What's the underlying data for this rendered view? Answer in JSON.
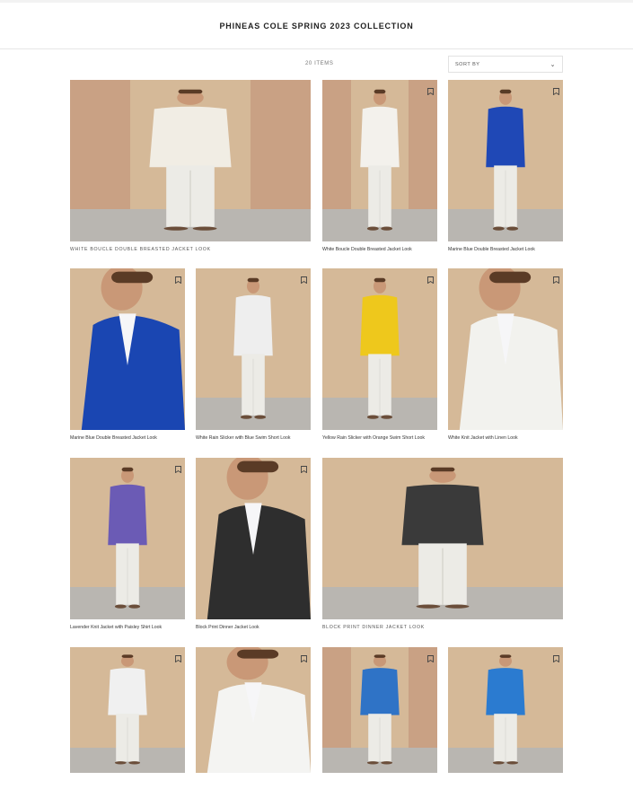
{
  "header": {
    "title": "PHINEAS COLE SPRING 2023 COLLECTION"
  },
  "toolbar": {
    "count": "20 ITEMS",
    "sort_label": "SORT BY"
  },
  "colors": {
    "background": "#ffffff",
    "text": "#222222",
    "studio_beige": "#d5b998",
    "studio_peach": "#c9a184",
    "floor_grey": "#b9b6b1"
  },
  "looks": [
    {
      "label": "WHITE BOUCLE DOUBLE BREASTED JACKET LOOK",
      "icon": "person-photo",
      "jacket": "#f1ede4"
    },
    {
      "label": "White Boucle Double Breasted Jacket Look",
      "icon": "person-photo",
      "jacket": "#f3f1ec"
    },
    {
      "label": "Marine Blue Double Breasted Jacket Look",
      "icon": "person-photo",
      "jacket": "#1f48b6"
    },
    {
      "label": "Marine Blue Double Breasted Jacket Look",
      "icon": "person-photo",
      "jacket": "#1a46b2"
    },
    {
      "label": "White Rain Slicker with Blue Swim Short Look",
      "icon": "person-photo",
      "jacket": "#eeeeee"
    },
    {
      "label": "Yellow Rain Slicker with Orange Swim Short Look",
      "icon": "person-photo",
      "jacket": "#eec81c"
    },
    {
      "label": "White Knit Jacket with Linen Look",
      "icon": "person-photo",
      "jacket": "#f2f2ee"
    },
    {
      "label": "Lavender Knit Jacket with Paisley Shirt Look",
      "icon": "person-photo",
      "jacket": "#6b5bb5"
    },
    {
      "label": "Block Print Dinner Jacket Look",
      "icon": "person-photo",
      "jacket": "#2e2e2e"
    },
    {
      "label": "BLOCK PRINT DINNER JACKET LOOK",
      "icon": "person-photo",
      "jacket": "#3a3a3a"
    },
    {
      "label": "",
      "icon": "person-photo",
      "jacket": "#f0f0f0"
    },
    {
      "label": "",
      "icon": "person-photo",
      "jacket": "#f4f4f2"
    },
    {
      "label": "",
      "icon": "person-photo",
      "jacket": "#2f73c6"
    },
    {
      "label": "",
      "icon": "person-photo",
      "jacket": "#2b7bd0"
    }
  ]
}
